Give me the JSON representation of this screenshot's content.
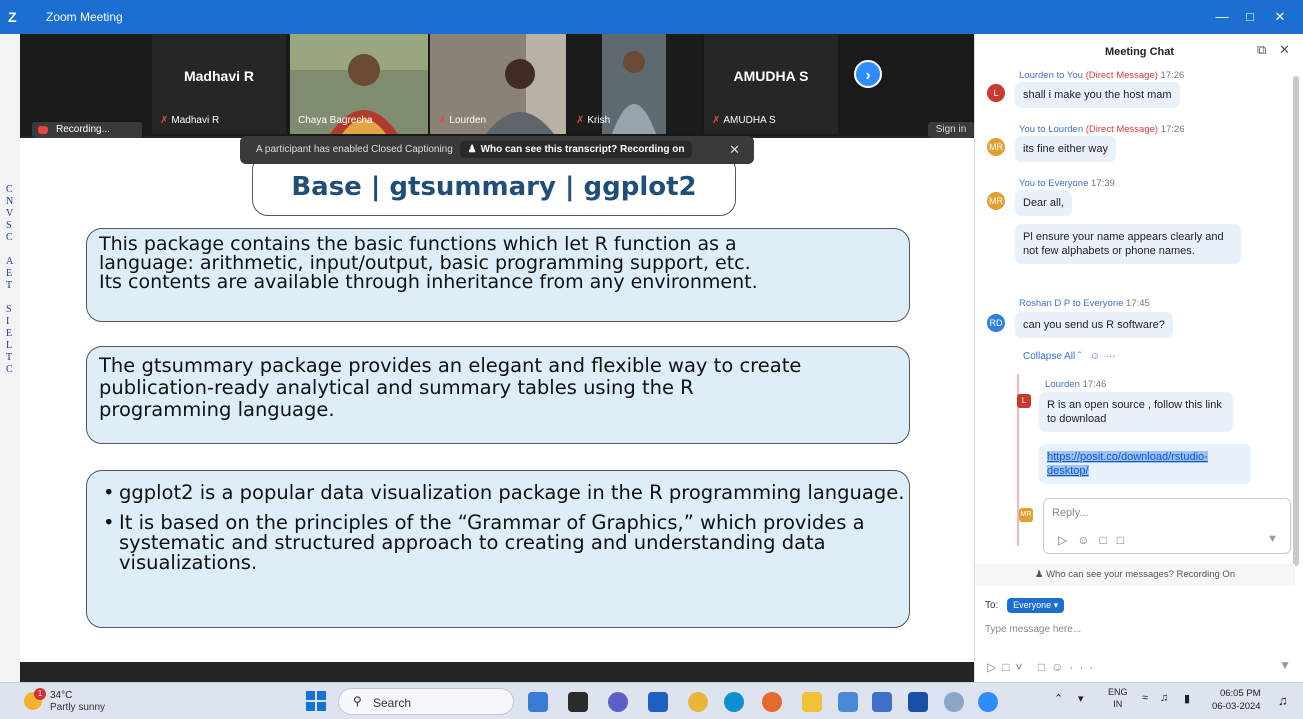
{
  "window": {
    "title": "Zoom Meeting",
    "logo": "Z"
  },
  "participants": [
    {
      "name": "Madhavi R",
      "label": "Madhavi R",
      "video": false
    },
    {
      "name": "",
      "label": "Chaya Bagrecha",
      "video": true
    },
    {
      "name": "",
      "label": "Lourden",
      "video": true
    },
    {
      "name": "",
      "label": "Krish",
      "video": true
    },
    {
      "name": "AMUDHA S",
      "label": "AMUDHA S",
      "video": false
    }
  ],
  "recording_label": "Recording...",
  "sign_in_label": "Sign in",
  "caption_banner": {
    "text": "A participant has enabled Closed Captioning",
    "link": "Who can see this transcript? Recording on"
  },
  "slide": {
    "title": "Base | gtsummary | ggplot2",
    "box1": [
      "This package contains the basic functions which let R function as a",
      "language: arithmetic, input/output, basic programming support, etc.",
      "Its contents are available through inheritance from any environment."
    ],
    "box2": [
      "The gtsummary package provides an elegant and flexible way to create",
      "publication-ready analytical and summary tables using the R",
      "programming language."
    ],
    "box3": [
      "ggplot2 is a popular data visualization package in the R programming language.",
      "It is based on the principles of the “Grammar of Graphics,” which provides a systematic and structured approach to creating and understanding data visualizations."
    ]
  },
  "chat": {
    "title": "Meeting Chat",
    "messages": [
      {
        "from": "Lourden",
        "to": "You",
        "dm": "(Direct Message)",
        "time": "17:26",
        "initials": "L",
        "text": "shall i make you the host mam"
      },
      {
        "from": "You",
        "to": "Lourden",
        "dm": "(Direct Message)",
        "time": "17:26",
        "initials": "MR",
        "text": "its fine either way"
      },
      {
        "from": "You",
        "to": "Everyone",
        "dm": "",
        "time": "17:39",
        "initials": "MR",
        "text": "Dear all,"
      },
      {
        "from": "",
        "to": "",
        "dm": "",
        "time": "",
        "initials": "",
        "text": "Pl ensure your name appears clearly and not few alphabets or phone names."
      },
      {
        "from": "Roshan D P",
        "to": "Everyone",
        "dm": "",
        "time": "17:45",
        "initials": "RD",
        "text": "can you send us R software?"
      }
    ],
    "collapse_label": "Collapse All",
    "reply": {
      "from": "Lourden",
      "time": "17:46",
      "initials": "L",
      "text": "R is an open source , follow this link to download",
      "link": "https://posit.co/download/rstudio-desktop/"
    },
    "reply_placeholder": "Reply...",
    "reply_initials": "MR",
    "privacy_text": "Who can see your messages? Recording On",
    "to_label": "To:",
    "to_value": "Everyone",
    "input_placeholder": "Type message here..."
  },
  "taskbar": {
    "weather_temp": "34°C",
    "weather_condition": "Partly sunny",
    "weather_badge": "1",
    "search_label": "Search",
    "lang_top": "ENG",
    "lang_bottom": "IN",
    "time": "06:05 PM",
    "date": "06-03-2024"
  }
}
